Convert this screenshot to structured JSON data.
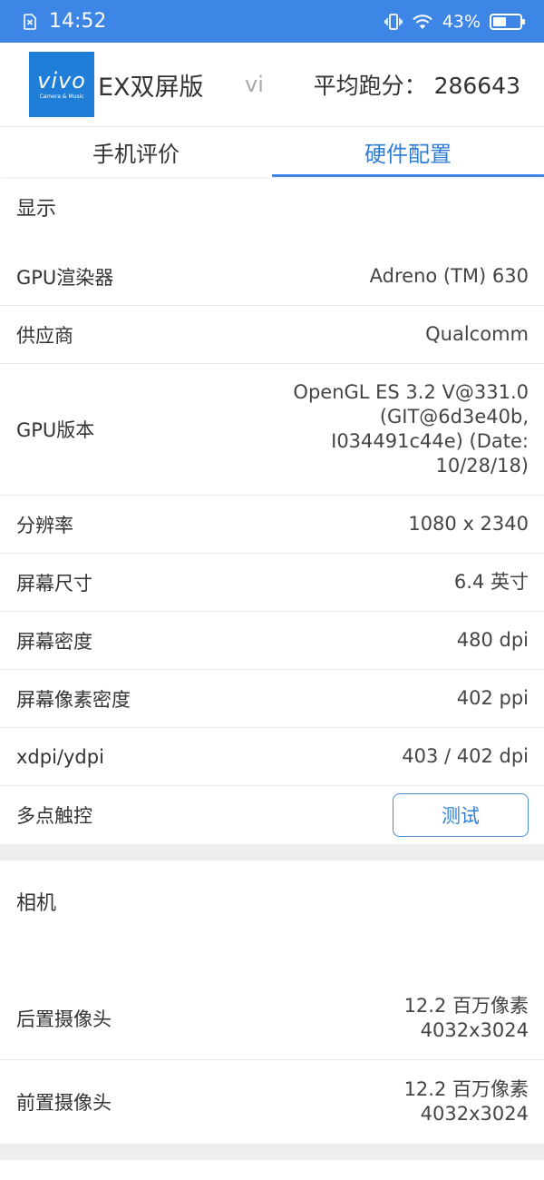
{
  "status_bar": {
    "time": "14:52",
    "battery": "43%",
    "icons": [
      "sim-x-icon",
      "vibrate-icon",
      "wifi-icon",
      "battery-icon"
    ]
  },
  "header": {
    "logo_text": "vivo",
    "logo_subtext": "Camera & Music",
    "device_name": "EX双屏版",
    "brand_fade": "vi",
    "score_label": "平均跑分：",
    "score_value": "286643"
  },
  "tabs": [
    {
      "label": "手机评价",
      "active": false
    },
    {
      "label": "硬件配置",
      "active": true
    }
  ],
  "display": {
    "title": "显示",
    "rows": [
      {
        "label": "GPU渲染器",
        "value": "Adreno (TM) 630"
      },
      {
        "label": "供应商",
        "value": "Qualcomm"
      },
      {
        "label": "GPU版本",
        "value_lines": [
          "OpenGL ES 3.2 V@331.0",
          "(GIT@6d3e40b,",
          "I034491c44e) (Date:",
          "10/28/18)"
        ]
      },
      {
        "label": "分辨率",
        "value": "1080 x 2340"
      },
      {
        "label": "屏幕尺寸",
        "value": "6.4 英寸"
      },
      {
        "label": "屏幕密度",
        "value": "480 dpi"
      },
      {
        "label": "屏幕像素密度",
        "value": "402 ppi"
      },
      {
        "label": "xdpi/ydpi",
        "value": "403 / 402 dpi"
      },
      {
        "label": "多点触控",
        "button": "测试"
      }
    ]
  },
  "camera": {
    "title": "相机",
    "rows": [
      {
        "label": "后置摄像头",
        "value_lines": [
          "12.2 百万像素",
          "4032x3024"
        ]
      },
      {
        "label": "前置摄像头",
        "value_lines": [
          "12.2 百万像素",
          "4032x3024"
        ]
      }
    ]
  },
  "colors": {
    "accent": "#3d86e6",
    "divider": "#eeeeee"
  }
}
